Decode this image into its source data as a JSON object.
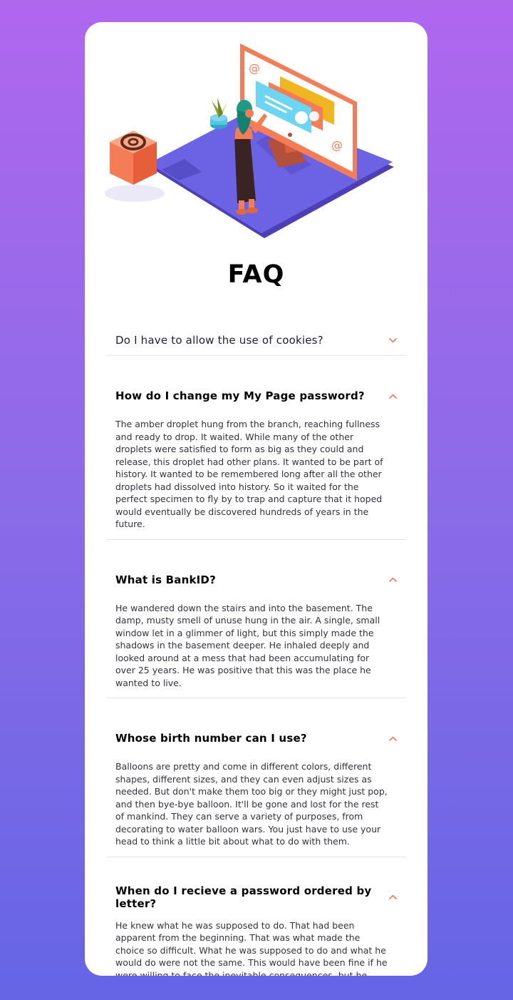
{
  "page": {
    "title": "FAQ"
  },
  "colors": {
    "accent": "#f47c57",
    "background_top": "#af67ee",
    "background_bottom": "#6565e5",
    "card": "#ffffff",
    "divider": "#e4e4e8"
  },
  "illustration": {
    "name": "faq-illustration"
  },
  "faq": [
    {
      "question": "Do I have to allow the use of cookies?",
      "answer": "",
      "expanded": false,
      "icon": "chevron-down-icon"
    },
    {
      "question": "How do I change my My Page password?",
      "answer": "The amber droplet hung from the branch, reaching fullness and ready to drop. It waited. While many of the other droplets were satisfied to form as big as they could and release, this droplet had other plans. It wanted to be part of history. It wanted to be remembered long after all the other droplets had dissolved into history. So it waited for the perfect specimen to fly by to trap and capture that it hoped would eventually be discovered hundreds of years in the future.",
      "expanded": true,
      "icon": "chevron-up-icon"
    },
    {
      "question": "What is BankID?",
      "answer": "He wandered down the stairs and into the basement. The damp, musty smell of unuse hung in the air. A single, small window let in a glimmer of light, but this simply made the shadows in the basement deeper. He inhaled deeply and looked around at a mess that had been accumulating for over 25 years. He was positive that this was the place he wanted to live.",
      "expanded": true,
      "icon": "chevron-up-icon"
    },
    {
      "question": "Whose birth number can I use?",
      "answer": "Balloons are pretty and come in different colors, different shapes, different sizes, and they can even adjust sizes as needed. But don't make them too big or they might just pop, and then bye-bye balloon. It'll be gone and lost for the rest of mankind. They can serve a variety of purposes, from decorating to water balloon wars. You just have to use your head to think a little bit about what to do with them.",
      "expanded": true,
      "icon": "chevron-up-icon"
    },
    {
      "question": "When do I recieve a password ordered by letter?",
      "answer": "He knew what he was supposed to do. That had been apparent from the beginning. That was what made the choice so difficult. What he was supposed to do and what he would do were not the same. This would have been fine if he were willing to face the inevitable consequences, but he wasn't.",
      "expanded": true,
      "icon": "chevron-up-icon"
    }
  ]
}
